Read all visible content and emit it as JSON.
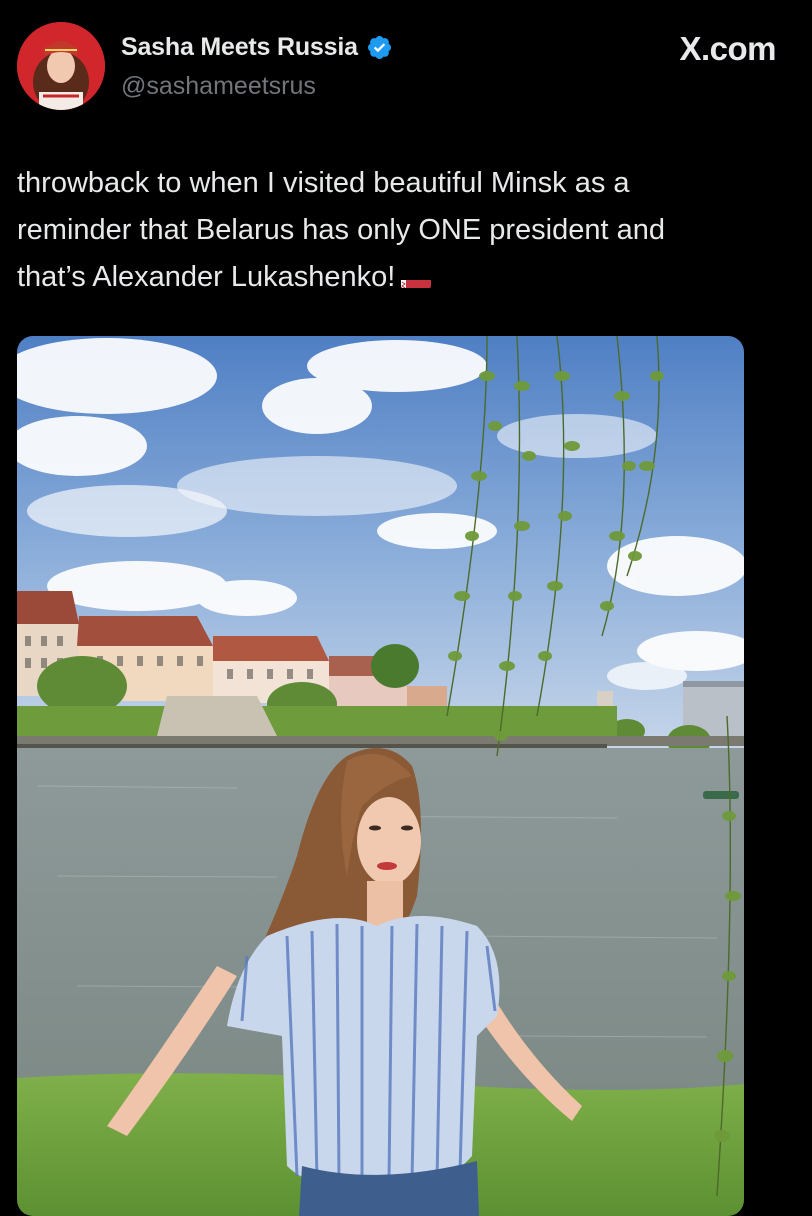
{
  "post": {
    "display_name": "Sasha Meets Russia",
    "handle": "@sashameetsrus",
    "brand": "X.com",
    "text_lines": [
      "throwback to when I visited beautiful Minsk as a",
      "reminder that Belarus has only ONE president and",
      "that’s Alexander Lukashenko!"
    ],
    "verified": true
  },
  "icons": {
    "verified": "verified-badge-icon",
    "flag": "belarus-flag-icon"
  },
  "colors": {
    "background": "#000000",
    "text": "#e7e9ea",
    "muted": "#71767b",
    "verified_blue": "#1d9bf0",
    "flag_red": "#c8313e",
    "flag_green": "#4aa657"
  }
}
